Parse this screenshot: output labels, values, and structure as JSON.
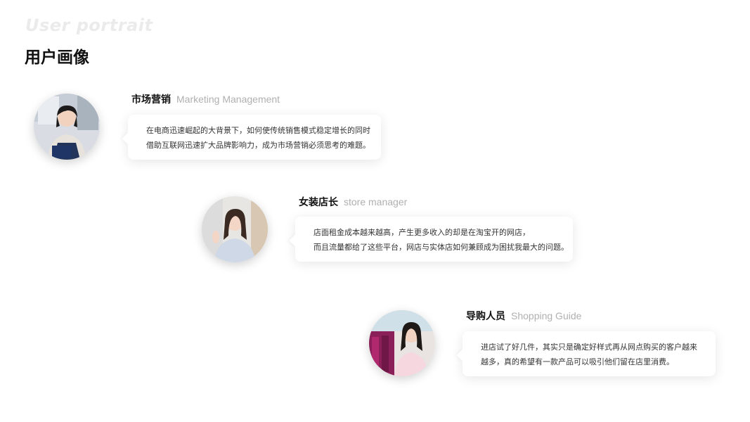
{
  "header": {
    "subtitle_en": "User portrait",
    "title_cn": "用户画像"
  },
  "personas": [
    {
      "role_cn": "市场营销",
      "role_en": "Marketing Management",
      "quote_lines": [
        "在电商迅速崛起的大背景下，如何使传统销售模式稳定增长的同时",
        "借助互联网迅速扩大品牌影响力，成为市场营销必须思考的难题。"
      ]
    },
    {
      "role_cn": "女装店长",
      "role_en": "store manager",
      "quote_lines": [
        "店面租金成本越来越高，产生更多收入的却是在淘宝开的网店，",
        "而且流量都给了这些平台，网店与实体店如何兼顾成为困扰我最大的问题。"
      ]
    },
    {
      "role_cn": "导购人员",
      "role_en": "Shopping Guide",
      "quote_lines": [
        "进店试了好几件，其实只是确定好样式再从网点购买的客户越来",
        "越多，真的希望有一款产品可以吸引他们留在店里消费。"
      ]
    }
  ]
}
